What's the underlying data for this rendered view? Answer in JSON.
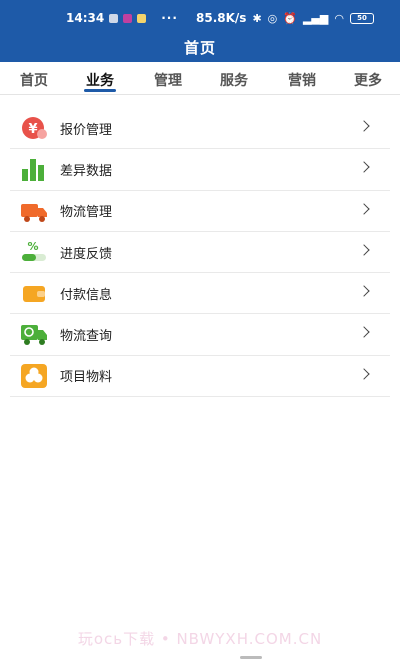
{
  "status_bar": {
    "time": "14:34",
    "dots": "···",
    "net_speed": "85.8K/s",
    "battery": "50"
  },
  "header": {
    "title": "首页"
  },
  "tabs": [
    {
      "label": "首页",
      "active": false
    },
    {
      "label": "业务",
      "active": true
    },
    {
      "label": "管理",
      "active": false
    },
    {
      "label": "服务",
      "active": false
    },
    {
      "label": "营销",
      "active": false
    },
    {
      "label": "更多",
      "active": false
    }
  ],
  "menu": [
    {
      "label": "报价管理",
      "icon": "quote-icon",
      "color": "#e8524a"
    },
    {
      "label": "差异数据",
      "icon": "bar-chart-icon",
      "color": "#4caf3a"
    },
    {
      "label": "物流管理",
      "icon": "truck-icon",
      "color": "#f06a2b"
    },
    {
      "label": "进度反馈",
      "icon": "progress-icon",
      "color": "#4caf3a"
    },
    {
      "label": "付款信息",
      "icon": "wallet-icon",
      "color": "#f5a623"
    },
    {
      "label": "物流查询",
      "icon": "truck-search-icon",
      "color": "#4caf3a"
    },
    {
      "label": "项目物料",
      "icon": "materials-icon",
      "color": "#f5a623"
    }
  ],
  "watermark": "玩ось下载 • NBWYXH.COM.CN",
  "colors": {
    "header": "#1e5aa8",
    "accent": "#1e5aa8"
  }
}
